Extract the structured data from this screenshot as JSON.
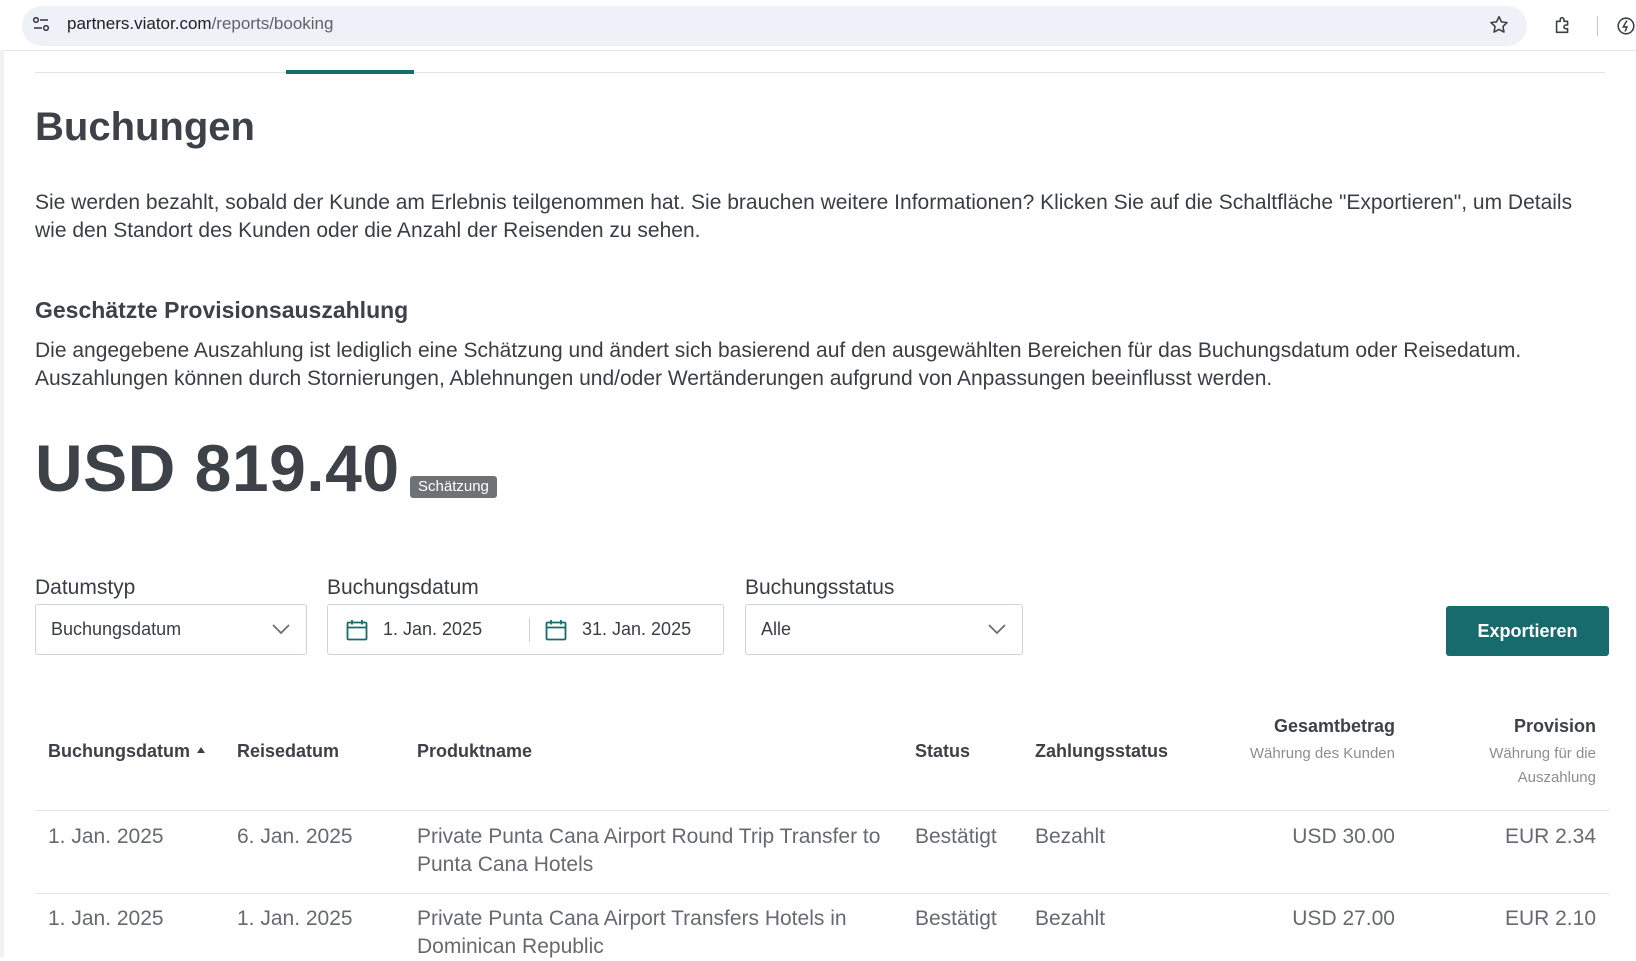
{
  "browser": {
    "url_host": "partners.viator.com",
    "url_path": "/reports/booking"
  },
  "page": {
    "title": "Buchungen",
    "intro": "Sie werden bezahlt, sobald der Kunde am Erlebnis teilgenommen hat. Sie brauchen weitere Informationen? Klicken Sie auf die Schaltfläche \"Exportieren\", um Details wie den Standort des Kunden oder die Anzahl der Reisenden zu sehen.",
    "payout_section_title": "Geschätzte Provisionsauszahlung",
    "payout_description": "Die angegebene Auszahlung ist lediglich eine Schätzung und ändert sich basierend auf den ausgewählten Bereichen für das Buchungsdatum oder Reisedatum. Auszahlungen können durch Stornierungen, Ablehnungen und/oder Wertänderungen aufgrund von Anpassungen beeinflusst werden.",
    "payout_amount": "USD 819.40",
    "payout_badge": "Schätzung"
  },
  "filters": {
    "date_type_label": "Datumstyp",
    "date_type_value": "Buchungsdatum",
    "booking_date_label": "Buchungsdatum",
    "date_from": "1. Jan. 2025",
    "date_to": "31. Jan. 2025",
    "status_label": "Buchungsstatus",
    "status_value": "Alle",
    "export_label": "Exportieren"
  },
  "table": {
    "headers": {
      "booking_date": "Buchungsdatum",
      "travel_date": "Reisedatum",
      "product": "Produktname",
      "status": "Status",
      "payment_status": "Zahlungsstatus",
      "total": "Gesamtbetrag",
      "total_sub": "Währung des Kunden",
      "commission": "Provision",
      "commission_sub": "Währung für die Auszahlung"
    },
    "rows": [
      {
        "booking_date": "1. Jan. 2025",
        "travel_date": "6. Jan. 2025",
        "product": "Private Punta Cana Airport Round Trip Transfer to Punta Cana Hotels",
        "status": "Bestätigt",
        "payment_status": "Bezahlt",
        "total": "USD 30.00",
        "commission": "EUR 2.34"
      },
      {
        "booking_date": "1. Jan. 2025",
        "travel_date": "1. Jan. 2025",
        "product": "Private Punta Cana Airport Transfers Hotels in Dominican Republic",
        "status": "Bestätigt",
        "payment_status": "Bezahlt",
        "total": "USD 27.00",
        "commission": "EUR 2.10"
      }
    ]
  },
  "colors": {
    "accent": "#186b6d",
    "badge": "#6e7276",
    "text": "#393e45"
  }
}
